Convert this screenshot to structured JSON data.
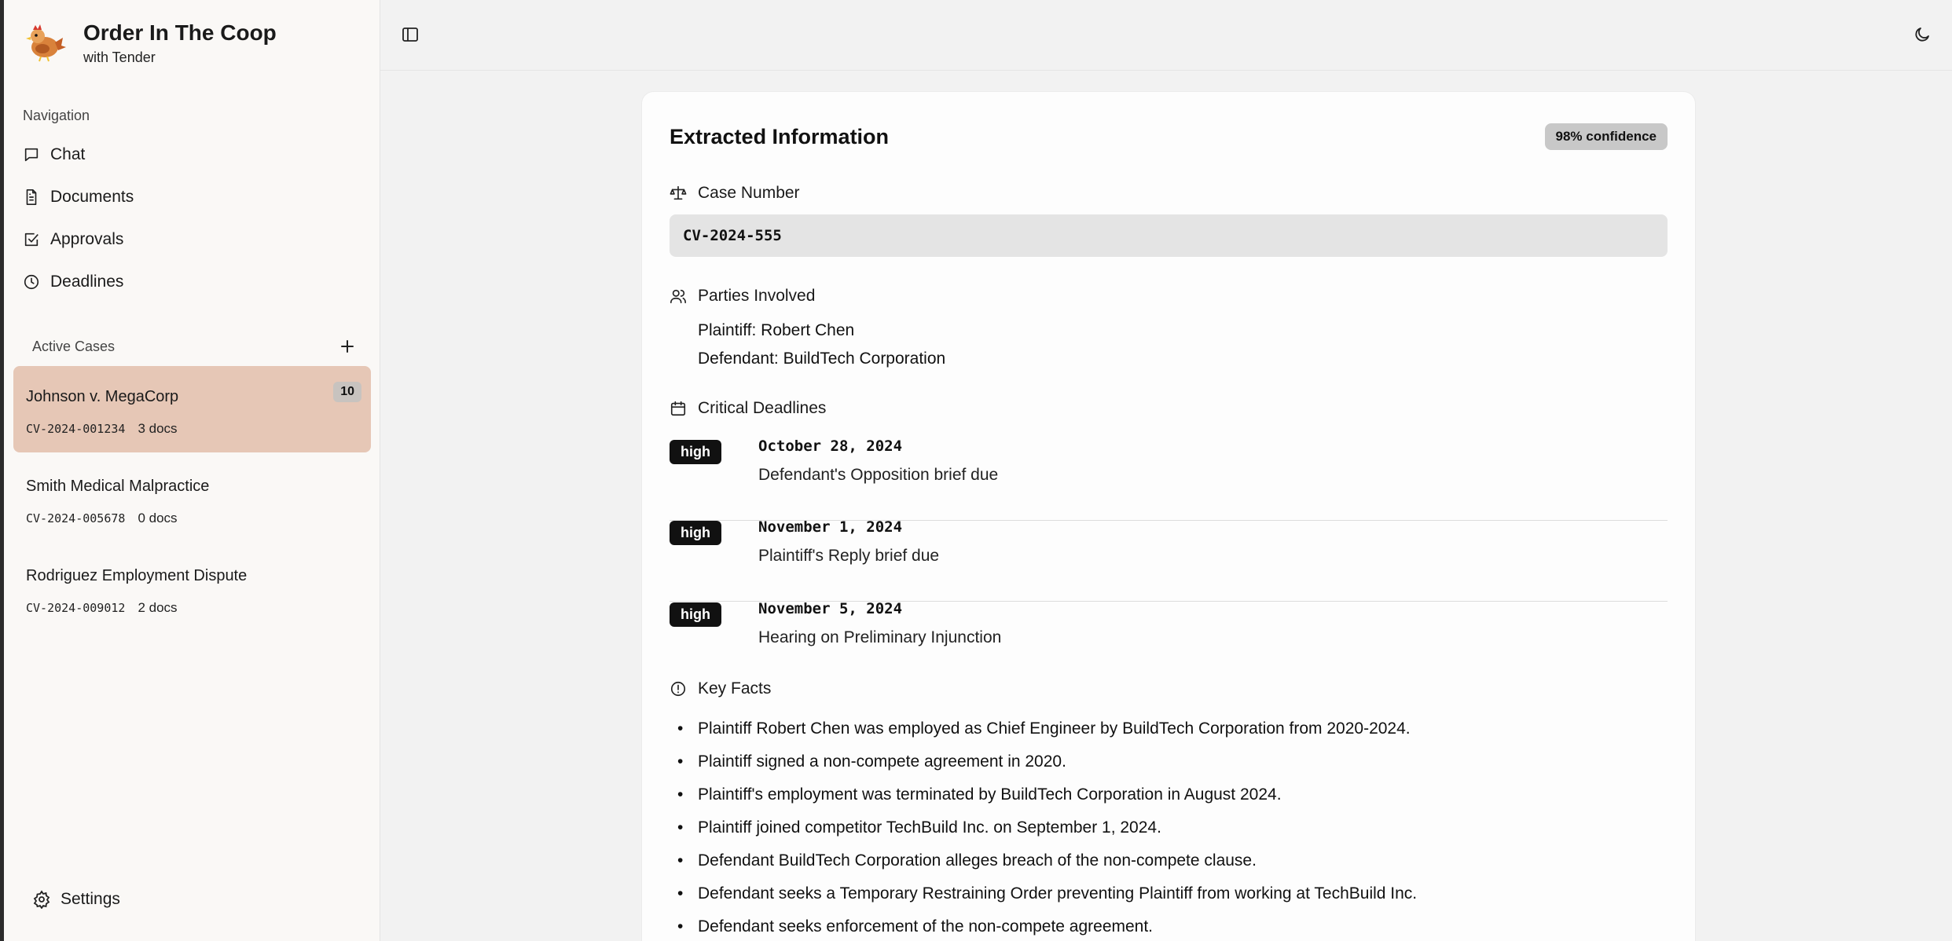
{
  "app": {
    "title": "Order In The Coop",
    "subtitle": "with Tender"
  },
  "nav": {
    "heading": "Navigation",
    "items": [
      {
        "label": "Chat",
        "icon": "chat-icon"
      },
      {
        "label": "Documents",
        "icon": "document-icon"
      },
      {
        "label": "Approvals",
        "icon": "checkbox-icon"
      },
      {
        "label": "Deadlines",
        "icon": "clock-icon"
      }
    ]
  },
  "cases": {
    "heading": "Active Cases",
    "items": [
      {
        "name": "Johnson v. MegaCorp",
        "number": "CV-2024-001234",
        "docs": "3 docs",
        "badge": "10",
        "active": true
      },
      {
        "name": "Smith Medical Malpractice",
        "number": "CV-2024-005678",
        "docs": "0 docs",
        "active": false
      },
      {
        "name": "Rodriguez Employment Dispute",
        "number": "CV-2024-009012",
        "docs": "2 docs",
        "active": false
      }
    ]
  },
  "settings_label": "Settings",
  "extracted": {
    "title": "Extracted Information",
    "confidence": "98% confidence",
    "case_number_label": "Case Number",
    "case_number": "CV-2024-555",
    "parties_label": "Parties Involved",
    "parties": [
      "Plaintiff: Robert Chen",
      "Defendant: BuildTech Corporation"
    ],
    "deadlines_label": "Critical Deadlines",
    "deadlines": [
      {
        "priority": "high",
        "date": "October 28, 2024",
        "description": "Defendant's Opposition brief due"
      },
      {
        "priority": "high",
        "date": "November 1, 2024",
        "description": "Plaintiff's Reply brief due"
      },
      {
        "priority": "high",
        "date": "November 5, 2024",
        "description": "Hearing on Preliminary Injunction"
      }
    ],
    "key_facts_label": "Key Facts",
    "key_facts": [
      "Plaintiff Robert Chen was employed as Chief Engineer by BuildTech Corporation from 2020-2024.",
      "Plaintiff signed a non-compete agreement in 2020.",
      "Plaintiff's employment was terminated by BuildTech Corporation in August 2024.",
      "Plaintiff joined competitor TechBuild Inc. on September 1, 2024.",
      "Defendant BuildTech Corporation alleges breach of the non-compete clause.",
      "Defendant seeks a Temporary Restraining Order preventing Plaintiff from working at TechBuild Inc.",
      "Defendant seeks enforcement of the non-compete agreement."
    ]
  },
  "colors": {
    "active_case_bg": "#e6c7b6",
    "priority_badge_bg": "#111111",
    "sidebar_bg": "#faf8f6",
    "main_bg": "#f2f2f2"
  }
}
